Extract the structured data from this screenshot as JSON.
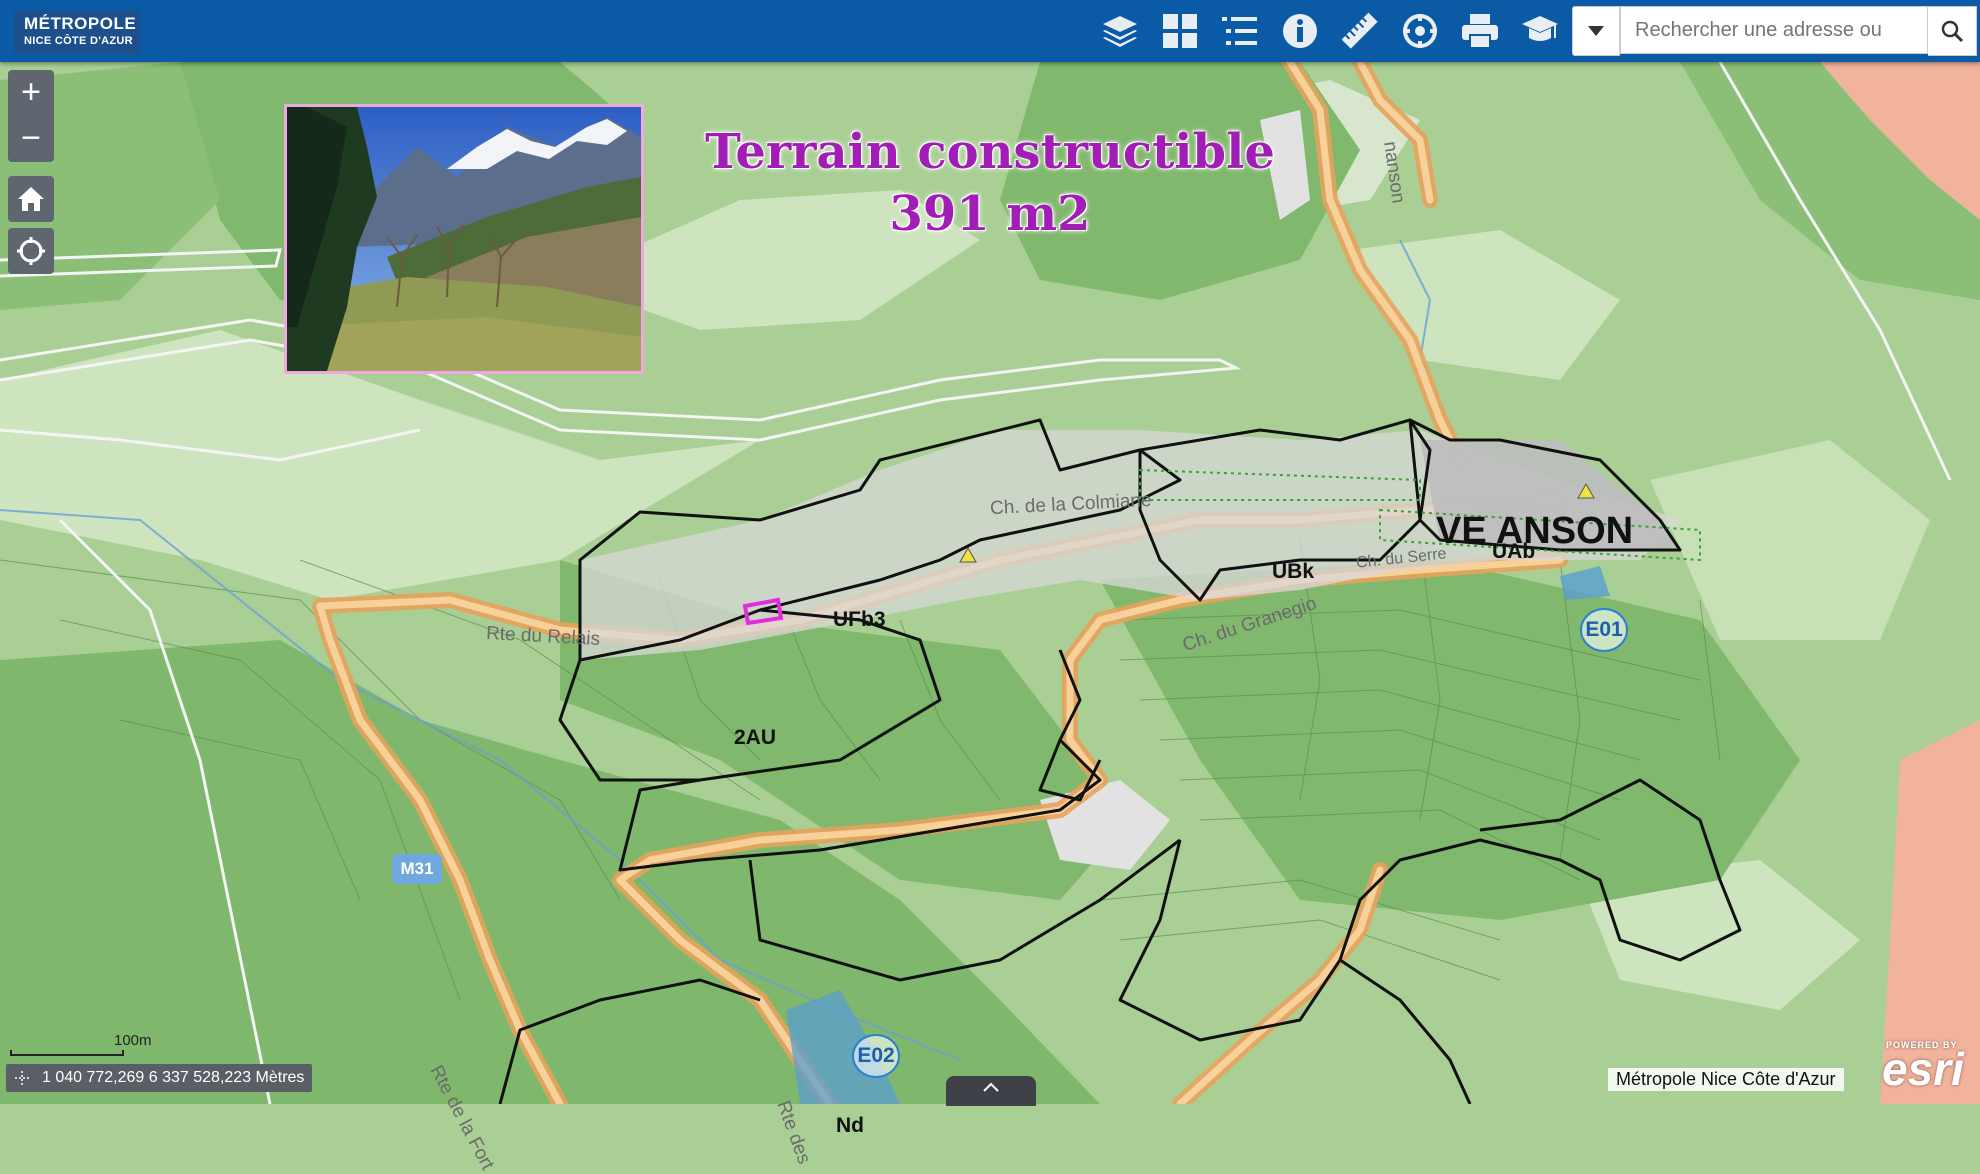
{
  "header": {
    "logo_line1": "MÉTROPOLE",
    "logo_line2": "NICE CÔTE D'AZUR",
    "tools": [
      {
        "name": "layers-icon"
      },
      {
        "name": "basemap-gallery-icon"
      },
      {
        "name": "legend-icon"
      },
      {
        "name": "info-icon"
      },
      {
        "name": "measure-icon"
      },
      {
        "name": "analysis-icon"
      },
      {
        "name": "print-icon"
      },
      {
        "name": "education-icon"
      }
    ],
    "search": {
      "placeholder": "Rechercher une adresse ou",
      "dropdown_icon": "caret-down-icon",
      "button_icon": "search-icon"
    }
  },
  "map_controls": {
    "zoom_in": "+",
    "zoom_out": "−",
    "home_icon": "home-icon",
    "locate_icon": "locate-icon"
  },
  "overlay": {
    "title_line1": "Terrain constructible",
    "title_line2": "391 m2"
  },
  "map_labels": {
    "village": "VENANSON",
    "village_visible": "VE  ANSON",
    "zones": [
      "UAb",
      "UBk",
      "UFb3",
      "2AU",
      "Nd"
    ],
    "badges": [
      "E01",
      "E02"
    ],
    "roads": [
      "Ch. de la Colmiane",
      "Rte du Relais",
      "Ch. du Granegio",
      "Rte de la Fort",
      "Rte des",
      "Ch. du Serre",
      "nanson"
    ],
    "route_shield": "M31"
  },
  "scale_bar": {
    "label": "100m"
  },
  "coordinates": "1 040 772,269 6 337 528,223 Mètres",
  "attribution": "Métropole Nice Côte d'Azur",
  "esri": {
    "powered": "POWERED BY",
    "brand": "esri"
  },
  "colors": {
    "header": "#0b5aa5",
    "map_green": "#a9cf95",
    "forest": "#7fb86c",
    "road": "#f5c07a",
    "zone_outline": "#111111",
    "title": "#a21cb6",
    "parcel_highlight": "#e22ddc"
  }
}
